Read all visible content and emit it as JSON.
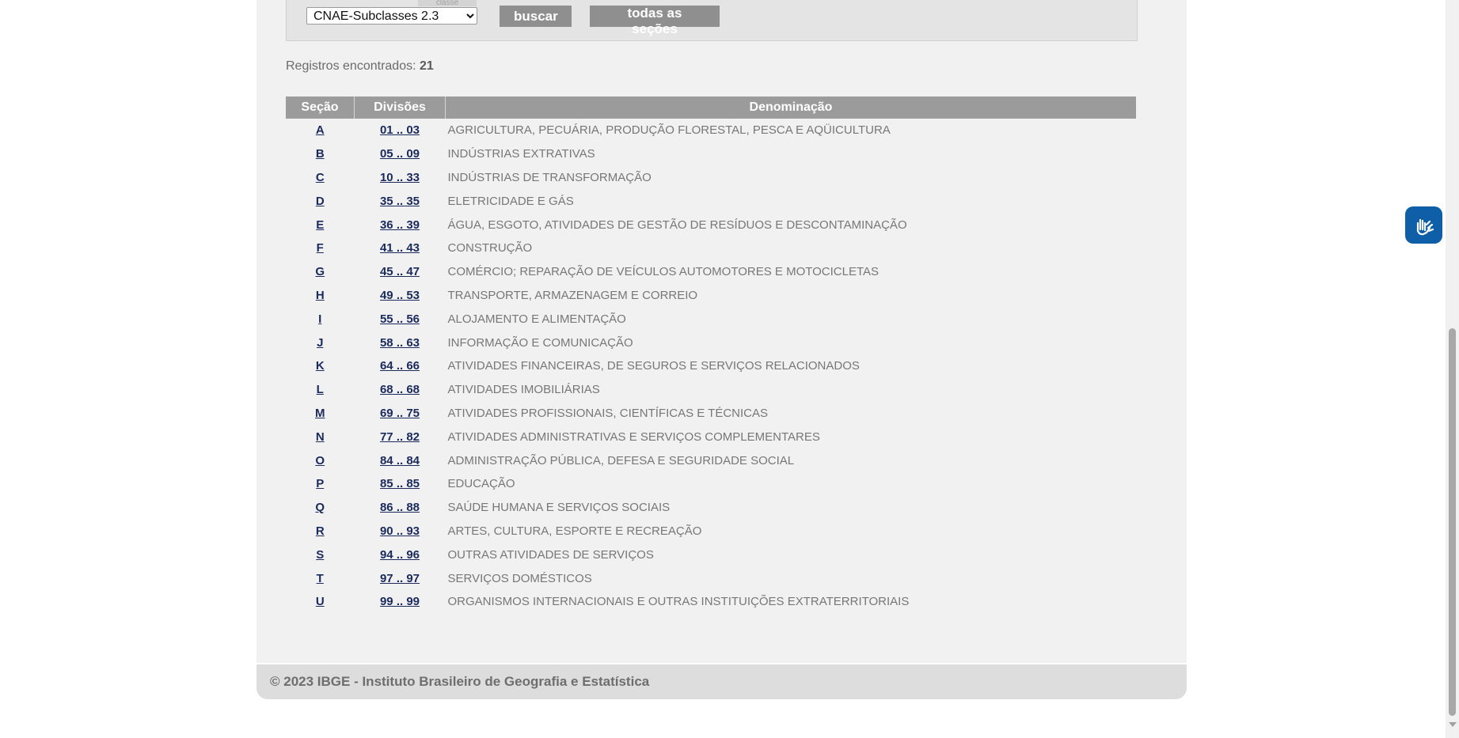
{
  "search": {
    "tab_label": "classe",
    "selected_classification": "CNAE-Subclasses 2.3",
    "buscar_label": "buscar",
    "todas_label": "todas as seções"
  },
  "records": {
    "label": "Registros encontrados:",
    "count": "21"
  },
  "table": {
    "headers": {
      "secao": "Seção",
      "divisoes": "Divisões",
      "denominacao": "Denominação"
    },
    "rows": [
      {
        "secao": "A",
        "divisoes": "01 .. 03",
        "denominacao": "AGRICULTURA, PECUÁRIA, PRODUÇÃO FLORESTAL, PESCA E AQÜICULTURA"
      },
      {
        "secao": "B",
        "divisoes": "05 .. 09",
        "denominacao": "INDÚSTRIAS EXTRATIVAS"
      },
      {
        "secao": "C",
        "divisoes": "10 .. 33",
        "denominacao": "INDÚSTRIAS DE TRANSFORMAÇÃO"
      },
      {
        "secao": "D",
        "divisoes": "35 .. 35",
        "denominacao": "ELETRICIDADE E GÁS"
      },
      {
        "secao": "E",
        "divisoes": "36 .. 39",
        "denominacao": "ÁGUA, ESGOTO, ATIVIDADES DE GESTÃO DE RESÍDUOS E DESCONTAMINAÇÃO"
      },
      {
        "secao": "F",
        "divisoes": "41 .. 43",
        "denominacao": "CONSTRUÇÃO"
      },
      {
        "secao": "G",
        "divisoes": "45 .. 47",
        "denominacao": "COMÉRCIO; REPARAÇÃO DE VEÍCULOS AUTOMOTORES E MOTOCICLETAS"
      },
      {
        "secao": "H",
        "divisoes": "49 .. 53",
        "denominacao": "TRANSPORTE, ARMAZENAGEM E CORREIO"
      },
      {
        "secao": "I",
        "divisoes": "55 .. 56",
        "denominacao": "ALOJAMENTO E ALIMENTAÇÃO"
      },
      {
        "secao": "J",
        "divisoes": "58 .. 63",
        "denominacao": "INFORMAÇÃO E COMUNICAÇÃO"
      },
      {
        "secao": "K",
        "divisoes": "64 .. 66",
        "denominacao": "ATIVIDADES FINANCEIRAS, DE SEGUROS E SERVIÇOS RELACIONADOS"
      },
      {
        "secao": "L",
        "divisoes": "68 .. 68",
        "denominacao": "ATIVIDADES IMOBILIÁRIAS"
      },
      {
        "secao": "M",
        "divisoes": "69 .. 75",
        "denominacao": "ATIVIDADES PROFISSIONAIS, CIENTÍFICAS E TÉCNICAS"
      },
      {
        "secao": "N",
        "divisoes": "77 .. 82",
        "denominacao": "ATIVIDADES ADMINISTRATIVAS E SERVIÇOS COMPLEMENTARES"
      },
      {
        "secao": "O",
        "divisoes": "84 .. 84",
        "denominacao": "ADMINISTRAÇÃO PÚBLICA, DEFESA E SEGURIDADE SOCIAL"
      },
      {
        "secao": "P",
        "divisoes": "85 .. 85",
        "denominacao": "EDUCAÇÃO"
      },
      {
        "secao": "Q",
        "divisoes": "86 .. 88",
        "denominacao": "SAÚDE HUMANA E SERVIÇOS SOCIAIS"
      },
      {
        "secao": "R",
        "divisoes": "90 .. 93",
        "denominacao": "ARTES, CULTURA, ESPORTE E RECREAÇÃO"
      },
      {
        "secao": "S",
        "divisoes": "94 .. 96",
        "denominacao": "OUTRAS ATIVIDADES DE SERVIÇOS"
      },
      {
        "secao": "T",
        "divisoes": "97 .. 97",
        "denominacao": "SERVIÇOS DOMÉSTICOS"
      },
      {
        "secao": "U",
        "divisoes": "99 .. 99",
        "denominacao": "ORGANISMOS INTERNACIONAIS E OUTRAS INSTITUIÇÕES EXTRATERRITORIAIS"
      }
    ]
  },
  "footer": {
    "text": "© 2023 IBGE - Instituto Brasileiro de Geografia e Estatística"
  },
  "widgets": {
    "accessibility_icon": "vlibras-hands-icon",
    "accessibility_color": "#0f5fa8"
  }
}
